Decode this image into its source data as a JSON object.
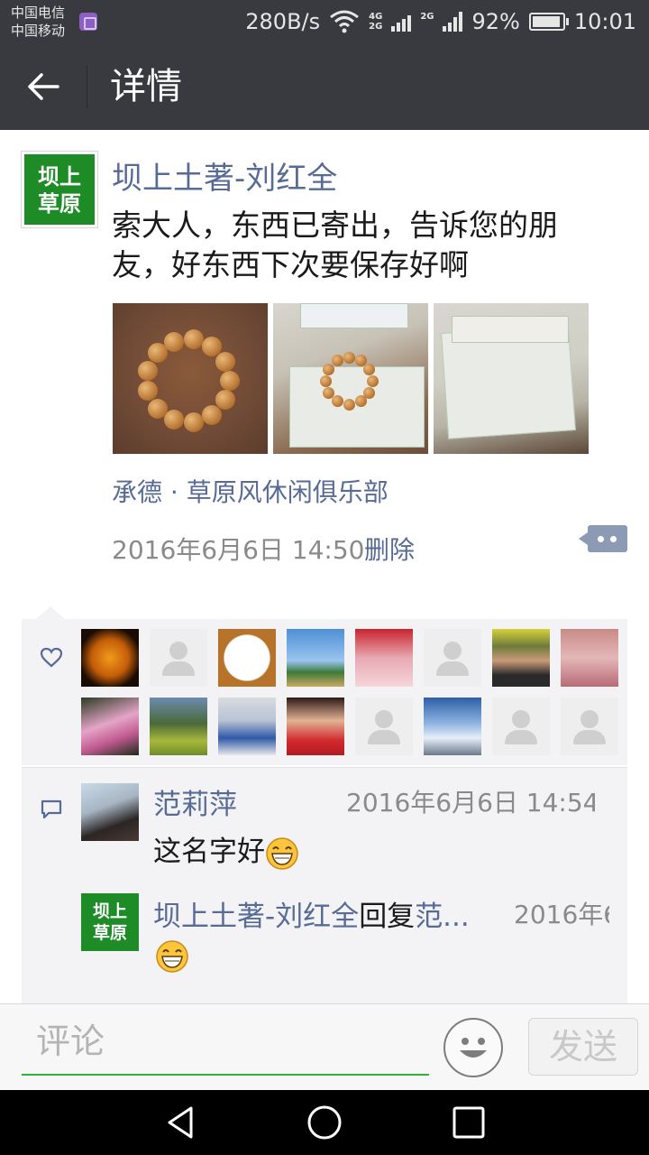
{
  "status_bar": {
    "carrier1": "中国电信",
    "carrier2": "中国移动",
    "net_speed": "280B/s",
    "net_badge_top": "4G",
    "net_badge_bottom": "2G",
    "net_badge2": "2G",
    "battery": "92%",
    "battery_level": 0.92,
    "time": "10:01"
  },
  "header": {
    "title": "详情",
    "back_icon": "back-arrow-icon"
  },
  "post": {
    "avatar_text_line1": "坝上",
    "avatar_text_line2": "草原",
    "author": "坝上土著-刘红全",
    "text": "索大人，东西已寄出，告诉您的朋友，好东西下次要保存好啊",
    "photo_count": 3,
    "location": "承德 · 草原风休闲俱乐部",
    "time": "2016年6月6日 14:50",
    "delete_label": "删除"
  },
  "likes": {
    "icon": "heart-icon",
    "count": 16
  },
  "comments": [
    {
      "author": "范莉萍",
      "time": "2016年6月6日 14:54",
      "text": "这名字好",
      "emoji": "grin-emoji"
    },
    {
      "author": "坝上土著-刘红全",
      "reply_word": "回复",
      "reply_to": "范...",
      "time": "2016年6",
      "text": "",
      "emoji": "grin-emoji"
    }
  ],
  "comment_bar": {
    "placeholder": "评论",
    "send_label": "发送",
    "emoji_icon": "smiley-icon"
  },
  "colors": {
    "accent_link": "#576b95",
    "brand_green": "#1e8c26",
    "titlebar": "#393a3f",
    "input_underline": "#2fb13a"
  }
}
